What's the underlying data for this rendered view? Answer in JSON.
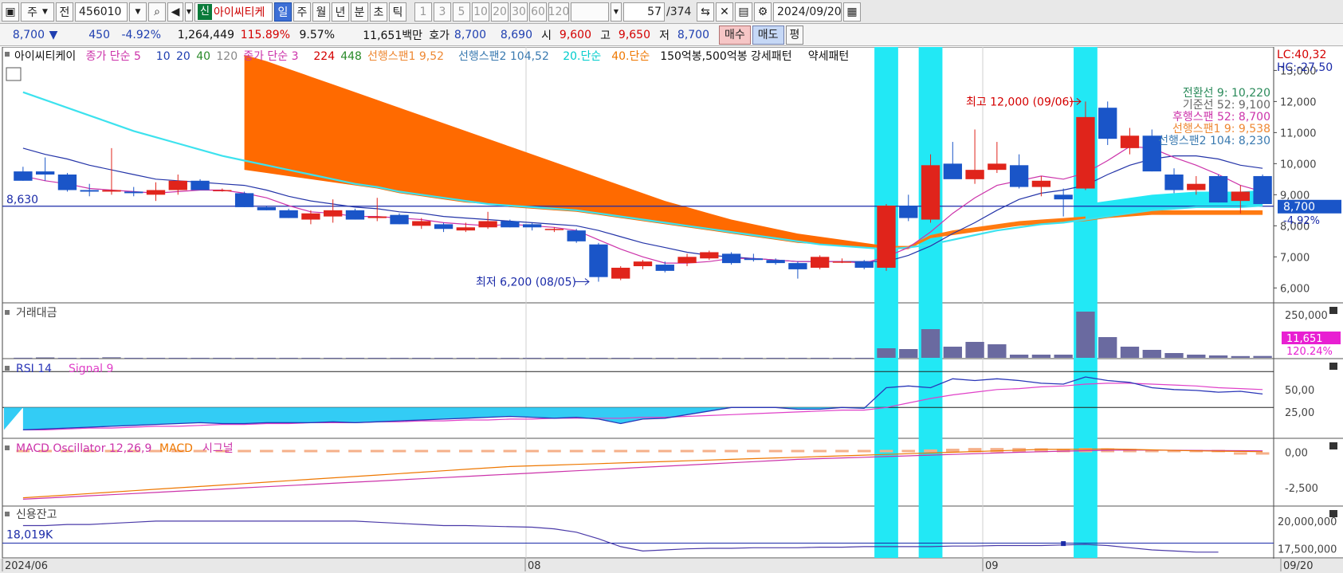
{
  "toolbar": {
    "period": "주",
    "prev_label": "전",
    "code": "456010",
    "search_icon": "search-icon",
    "sound_icon": "speaker-icon",
    "sin_badge": "신",
    "stock_name": "아이씨티케",
    "tf": [
      "일",
      "주",
      "월",
      "년",
      "분",
      "초",
      "틱"
    ],
    "tf_selected": "일",
    "nums": [
      "1",
      "3",
      "5",
      "10",
      "20",
      "30",
      "60",
      "120"
    ],
    "count_value": "57",
    "count_total": "/374",
    "date": "2024/09/20"
  },
  "quote": {
    "price": "8,700",
    "down_arrow": "▼",
    "change": "450",
    "change_pct": "-4.92%",
    "volume": "1,264,449",
    "vol_ratio": "115.89%",
    "turnover": "9.57%",
    "amount": "11,651백만",
    "hoga_label": "호가",
    "ask": "8,700",
    "bid": "8,690",
    "open_label": "시",
    "open": "9,600",
    "high_label": "고",
    "high": "9,650",
    "low_label": "저",
    "low": "8,700",
    "buy_label": "매수",
    "sell_label": "매도",
    "avg_label": "평"
  },
  "price_panel": {
    "legend": [
      {
        "text": "아이씨티케이",
        "color": "#111111"
      },
      {
        "text": "종가 단순 5",
        "color": "#cc33aa"
      },
      {
        "text": "10",
        "color": "#1f3fb0"
      },
      {
        "text": "20",
        "color": "#1f3fb0"
      },
      {
        "text": "40",
        "color": "#2a8a2a"
      },
      {
        "text": "120",
        "color": "#888888"
      },
      {
        "text": "종가 단순 3",
        "color": "#cc33aa"
      },
      {
        "text": "224",
        "color": "#d40000"
      },
      {
        "text": "448",
        "color": "#2a8a2a"
      },
      {
        "text": "선행스팬1 9,52",
        "color": "#ee8833"
      },
      {
        "text": "선행스팬2 104,52",
        "color": "#3a7ab0"
      },
      {
        "text": "20.단순",
        "color": "#00cccc"
      },
      {
        "text": "40.단순",
        "color": "#ee7700"
      },
      {
        "text": "150억봉,500억봉 강세패턴",
        "color": "#111111"
      },
      {
        "text": "약세패턴",
        "color": "#111111"
      }
    ],
    "lc": "LC:40,32",
    "hc": "HC:-27,50",
    "ref_line_label": "8,630",
    "price_tag": "8,700",
    "pct_tag": "-4.92%",
    "axis": [
      "13,000",
      "12,000",
      "11,000",
      "10,000",
      "9,000",
      "8,000",
      "7,000",
      "6,000"
    ],
    "high_annot": "최고 12,000 (09/06)",
    "low_annot": "최저 6,200 (08/05)",
    "ichimoku": [
      {
        "text": "전환선 9: 10,220",
        "color": "#2a8a5a"
      },
      {
        "text": "기준선 52: 9,100",
        "color": "#666666"
      },
      {
        "text": "후행스팬 52: 8,700",
        "color": "#cc33aa"
      },
      {
        "text": "선행스팬1 9: 9,538",
        "color": "#ee8833"
      },
      {
        "text": "선행스팬2 104: 8,230",
        "color": "#3a7ab0"
      }
    ]
  },
  "volume_panel": {
    "title": "거래대금",
    "axis": [
      "250,000"
    ],
    "tag": "11,651",
    "pct": "120.24%"
  },
  "rsi_panel": {
    "title": "RSI 14",
    "signal": "Signal 9",
    "axis": [
      "50,00",
      "25,00"
    ]
  },
  "macd_panel": {
    "title": "MACD Oscillator 12,26,9",
    "macd": "MACD",
    "signal": "시그널",
    "axis": [
      "0,00",
      "-2,500"
    ]
  },
  "credit_panel": {
    "title": "신용잔고",
    "value": "18,019K",
    "axis": [
      "20,000,000",
      "17,500,000"
    ]
  },
  "x_axis": [
    "2024/06",
    "08",
    "09",
    "09/20"
  ],
  "chart_data": {
    "type": "candlestick",
    "title": "아이씨티케이",
    "ylim": [
      5700,
      13600
    ],
    "candles": [
      {
        "o": 9750,
        "h": 9900,
        "l": 9450,
        "c": 9450
      },
      {
        "o": 9750,
        "h": 10200,
        "l": 9450,
        "c": 9650
      },
      {
        "o": 9650,
        "h": 9700,
        "l": 9100,
        "c": 9150
      },
      {
        "o": 9150,
        "h": 9350,
        "l": 8950,
        "c": 9100
      },
      {
        "o": 9100,
        "h": 10500,
        "l": 9000,
        "c": 9150
      },
      {
        "o": 9100,
        "h": 9250,
        "l": 8950,
        "c": 9050
      },
      {
        "o": 9000,
        "h": 9400,
        "l": 8800,
        "c": 9150
      },
      {
        "o": 9150,
        "h": 9650,
        "l": 9000,
        "c": 9450
      },
      {
        "o": 9450,
        "h": 9500,
        "l": 9150,
        "c": 9150
      },
      {
        "o": 9150,
        "h": 9200,
        "l": 9100,
        "c": 9150
      },
      {
        "o": 9050,
        "h": 9100,
        "l": 8600,
        "c": 8600
      },
      {
        "o": 8600,
        "h": 8650,
        "l": 8500,
        "c": 8500
      },
      {
        "o": 8500,
        "h": 8550,
        "l": 8250,
        "c": 8250
      },
      {
        "o": 8200,
        "h": 8500,
        "l": 8050,
        "c": 8400
      },
      {
        "o": 8300,
        "h": 8850,
        "l": 8100,
        "c": 8500
      },
      {
        "o": 8500,
        "h": 8550,
        "l": 8200,
        "c": 8200
      },
      {
        "o": 8250,
        "h": 8900,
        "l": 8150,
        "c": 8300
      },
      {
        "o": 8350,
        "h": 8400,
        "l": 8050,
        "c": 8050
      },
      {
        "o": 8000,
        "h": 8250,
        "l": 7900,
        "c": 8150
      },
      {
        "o": 8050,
        "h": 8100,
        "l": 7800,
        "c": 7900
      },
      {
        "o": 7850,
        "h": 8100,
        "l": 7800,
        "c": 7950
      },
      {
        "o": 7950,
        "h": 8450,
        "l": 7900,
        "c": 8150
      },
      {
        "o": 8150,
        "h": 8200,
        "l": 7950,
        "c": 7950
      },
      {
        "o": 8050,
        "h": 8100,
        "l": 7850,
        "c": 7950
      },
      {
        "o": 7900,
        "h": 7950,
        "l": 7800,
        "c": 7900
      },
      {
        "o": 7850,
        "h": 7900,
        "l": 7450,
        "c": 7500
      },
      {
        "o": 7400,
        "h": 7450,
        "l": 6200,
        "c": 6350
      },
      {
        "o": 6300,
        "h": 6700,
        "l": 6250,
        "c": 6650
      },
      {
        "o": 6700,
        "h": 6900,
        "l": 6600,
        "c": 6850
      },
      {
        "o": 6750,
        "h": 6850,
        "l": 6500,
        "c": 6550
      },
      {
        "o": 6800,
        "h": 7100,
        "l": 6700,
        "c": 7000
      },
      {
        "o": 6950,
        "h": 7200,
        "l": 6900,
        "c": 7150
      },
      {
        "o": 7100,
        "h": 7150,
        "l": 6750,
        "c": 6800
      },
      {
        "o": 6950,
        "h": 7100,
        "l": 6850,
        "c": 6900
      },
      {
        "o": 6900,
        "h": 6950,
        "l": 6750,
        "c": 6800
      },
      {
        "o": 6800,
        "h": 6850,
        "l": 6300,
        "c": 6600
      },
      {
        "o": 6650,
        "h": 7050,
        "l": 6600,
        "c": 7000
      },
      {
        "o": 6850,
        "h": 6950,
        "l": 6800,
        "c": 6850
      },
      {
        "o": 6850,
        "h": 6900,
        "l": 6600,
        "c": 6650
      },
      {
        "o": 6650,
        "h": 8700,
        "l": 6550,
        "c": 8650
      },
      {
        "o": 8650,
        "h": 9000,
        "l": 8150,
        "c": 8250
      },
      {
        "o": 8200,
        "h": 10300,
        "l": 8100,
        "c": 9950
      },
      {
        "o": 10000,
        "h": 10700,
        "l": 9600,
        "c": 9500
      },
      {
        "o": 9500,
        "h": 11100,
        "l": 9350,
        "c": 9800
      },
      {
        "o": 9800,
        "h": 10700,
        "l": 9700,
        "c": 10000
      },
      {
        "o": 9950,
        "h": 10300,
        "l": 9200,
        "c": 9250
      },
      {
        "o": 9250,
        "h": 9600,
        "l": 8950,
        "c": 9450
      },
      {
        "o": 9000,
        "h": 9200,
        "l": 8300,
        "c": 8850
      },
      {
        "o": 9200,
        "h": 12000,
        "l": 9150,
        "c": 11500
      },
      {
        "o": 11800,
        "h": 12000,
        "l": 10600,
        "c": 10800
      },
      {
        "o": 10500,
        "h": 11150,
        "l": 10300,
        "c": 10900
      },
      {
        "o": 10900,
        "h": 11100,
        "l": 9750,
        "c": 9750
      },
      {
        "o": 9650,
        "h": 9850,
        "l": 9050,
        "c": 9150
      },
      {
        "o": 9150,
        "h": 9600,
        "l": 9000,
        "c": 9350
      },
      {
        "o": 9600,
        "h": 9650,
        "l": 8750,
        "c": 8750
      },
      {
        "o": 8800,
        "h": 9300,
        "l": 8400,
        "c": 9100
      },
      {
        "o": 9600,
        "h": 9650,
        "l": 8700,
        "c": 8700
      }
    ],
    "highlight_index": [
      39,
      41,
      48
    ],
    "ma_line": [
      9600,
      9450,
      9350,
      9200,
      9150,
      9100,
      9050,
      9100,
      9150,
      9150,
      9050,
      8900,
      8650,
      8450,
      8400,
      8300,
      8300,
      8250,
      8200,
      8100,
      8050,
      8000,
      8050,
      8000,
      7950,
      7850,
      7550,
      7250,
      7000,
      6800,
      6800,
      6850,
      6950,
      6950,
      6900,
      6850,
      6850,
      6850,
      6800,
      7000,
      7300,
      7800,
      8400,
      8900,
      9300,
      9450,
      9600,
      9500,
      9700,
      10100,
      10550,
      10500,
      10200,
      9950,
      9650,
      9300,
      9100
    ],
    "ma10_line": [
      10500,
      10300,
      10150,
      9950,
      9800,
      9650,
      9500,
      9450,
      9400,
      9350,
      9300,
      9150,
      8950,
      8800,
      8700,
      8600,
      8550,
      8450,
      8400,
      8300,
      8250,
      8200,
      8150,
      8100,
      8050,
      8000,
      7850,
      7650,
      7450,
      7300,
      7150,
      7050,
      7000,
      6950,
      6900,
      6850,
      6850,
      6850,
      6850,
      6850,
      7050,
      7350,
      7750,
      8100,
      8500,
      8850,
      9050,
      9150,
      9300,
      9650,
      9950,
      10150,
      10250,
      10250,
      10150,
      9950,
      9850
    ],
    "ma20_line": [
      12300,
      12050,
      11800,
      11550,
      11300,
      11050,
      10850,
      10650,
      10450,
      10250,
      10100,
      9950,
      9800,
      9650,
      9500,
      9350,
      9250,
      9100,
      9000,
      8900,
      8800,
      8700,
      8650,
      8600,
      8550,
      8500,
      8400,
      8300,
      8200,
      8100,
      8000,
      7900,
      7800,
      7700,
      7600,
      7500,
      7400,
      7350,
      7300,
      7250,
      7300,
      7400,
      7550,
      7700,
      7850,
      7950,
      8050,
      8100,
      8200,
      8300,
      8400,
      8500,
      8550,
      8600,
      8600,
      8600,
      8650
    ],
    "cloud_top": [
      null,
      null,
      null,
      null,
      null,
      null,
      null,
      null,
      null,
      null,
      13500,
      13300,
      13050,
      12800,
      12550,
      12300,
      12050,
      11800,
      11550,
      11300,
      11050,
      10800,
      10550,
      10300,
      10050,
      9800,
      9550,
      9300,
      9050,
      8800,
      8600,
      8400,
      8200,
      8050,
      7900,
      7750,
      7650,
      7550,
      7450,
      7350,
      7350,
      7700,
      7850,
      7950,
      8050,
      8150,
      8200,
      8250,
      8300,
      8350,
      8450,
      8500,
      8500,
      8500,
      8500,
      8500,
      8500
    ],
    "cloud_bottom": [
      null,
      null,
      null,
      null,
      null,
      null,
      null,
      null,
      null,
      null,
      9800,
      9700,
      9600,
      9500,
      9400,
      9300,
      9200,
      9050,
      8950,
      8850,
      8750,
      8700,
      8600,
      8550,
      8500,
      8450,
      8350,
      8250,
      8150,
      8050,
      7950,
      7850,
      7750,
      7650,
      7550,
      7450,
      7400,
      7350,
      7300,
      7250,
      7250,
      7600,
      7700,
      7800,
      7900,
      8000,
      8050,
      8100,
      8150,
      8250,
      8300,
      8350,
      8350,
      8350,
      8350,
      8350,
      8350
    ],
    "volume": [
      500,
      2500,
      200,
      200,
      3500,
      200,
      200,
      200,
      200,
      200,
      200,
      200,
      200,
      200,
      200,
      200,
      200,
      200,
      200,
      200,
      200,
      200,
      200,
      200,
      200,
      200,
      200,
      200,
      200,
      200,
      200,
      200,
      200,
      200,
      200,
      200,
      200,
      200,
      200,
      60000,
      55000,
      180000,
      70000,
      100000,
      85000,
      20000,
      20000,
      20000,
      290000,
      130000,
      70000,
      50000,
      30000,
      20000,
      15000,
      11000,
      11651
    ],
    "volume_ylim": [
      0,
      310000
    ],
    "rsi": [
      5,
      6,
      7,
      8,
      9,
      10,
      11,
      12,
      13,
      12,
      12,
      13,
      13,
      13,
      14,
      13,
      14,
      15,
      16,
      17,
      18,
      19,
      20,
      19,
      18,
      19,
      17,
      12,
      17,
      18,
      22,
      26,
      30,
      30,
      30,
      28,
      28,
      30,
      29,
      52,
      54,
      52,
      62,
      60,
      62,
      60,
      57,
      56,
      64,
      60,
      58,
      52,
      50,
      49,
      47,
      48,
      45
    ],
    "rsi_signal": [
      5,
      5,
      6,
      7,
      7,
      8,
      9,
      9,
      10,
      11,
      11,
      12,
      12,
      13,
      13,
      13,
      14,
      14,
      15,
      15,
      16,
      16,
      17,
      17,
      18,
      18,
      18,
      18,
      19,
      19,
      20,
      21,
      22,
      23,
      24,
      25,
      26,
      27,
      27,
      30,
      35,
      40,
      44,
      47,
      50,
      51,
      53,
      54,
      56,
      57,
      57,
      56,
      55,
      54,
      52,
      51,
      50
    ],
    "rsi_ylim": [
      0,
      80
    ],
    "macd_osc": [
      0,
      0,
      0,
      0,
      0,
      0,
      0,
      0,
      0,
      0,
      0,
      0,
      0,
      0,
      0,
      0,
      0,
      0,
      0,
      0,
      0,
      0,
      0,
      0,
      0,
      0,
      0,
      0,
      0,
      0,
      0,
      0,
      0,
      0,
      0,
      0,
      0,
      0,
      0,
      100,
      150,
      200,
      250,
      300,
      300,
      300,
      280,
      250,
      300,
      280,
      240,
      180,
      120,
      60,
      0,
      -60,
      -100
    ],
    "macd": [
      -3200,
      -3100,
      -3000,
      -2900,
      -2800,
      -2700,
      -2600,
      -2500,
      -2400,
      -2300,
      -2200,
      -2100,
      -2000,
      -1900,
      -1800,
      -1700,
      -1600,
      -1500,
      -1400,
      -1300,
      -1200,
      -1100,
      -1000,
      -950,
      -900,
      -850,
      -800,
      -750,
      -700,
      -650,
      -600,
      -550,
      -500,
      -450,
      -400,
      -350,
      -300,
      -250,
      -200,
      -150,
      -100,
      -50,
      0,
      50,
      100,
      150,
      200,
      200,
      220,
      230,
      200,
      170,
      130,
      100,
      80,
      60,
      40
    ],
    "macd_signal": [
      -3300,
      -3220,
      -3140,
      -3060,
      -2980,
      -2900,
      -2820,
      -2740,
      -2660,
      -2580,
      -2500,
      -2420,
      -2340,
      -2260,
      -2180,
      -2100,
      -2020,
      -1940,
      -1860,
      -1780,
      -1700,
      -1620,
      -1540,
      -1460,
      -1380,
      -1300,
      -1220,
      -1140,
      -1060,
      -980,
      -900,
      -820,
      -740,
      -660,
      -580,
      -500,
      -450,
      -400,
      -350,
      -300,
      -250,
      -200,
      -150,
      -100,
      -50,
      0,
      40,
      80,
      110,
      140,
      150,
      150,
      140,
      130,
      120,
      110,
      100
    ],
    "macd_ylim": [
      -3500,
      700
    ],
    "credit": [
      19600000,
      19600000,
      19700000,
      19700000,
      19800000,
      19900000,
      20000000,
      20000000,
      20000000,
      20000000,
      20000000,
      20000000,
      20000000,
      20000000,
      20000000,
      20000000,
      19900000,
      19800000,
      19700000,
      19600000,
      19600000,
      19550000,
      19500000,
      19450000,
      19300000,
      19000000,
      18400000,
      17700000,
      17300000,
      17400000,
      17500000,
      17550000,
      17550000,
      17600000,
      17600000,
      17600000,
      17650000,
      17650000,
      17700000,
      17700000,
      17700000,
      17700000,
      17750000,
      17750000,
      17800000,
      17800000,
      17800000,
      17850000,
      17900000,
      17800000,
      17600000,
      17400000,
      17300000,
      17200000,
      17200000,
      null,
      null
    ],
    "credit_ylim": [
      16900000,
      21000000
    ]
  }
}
